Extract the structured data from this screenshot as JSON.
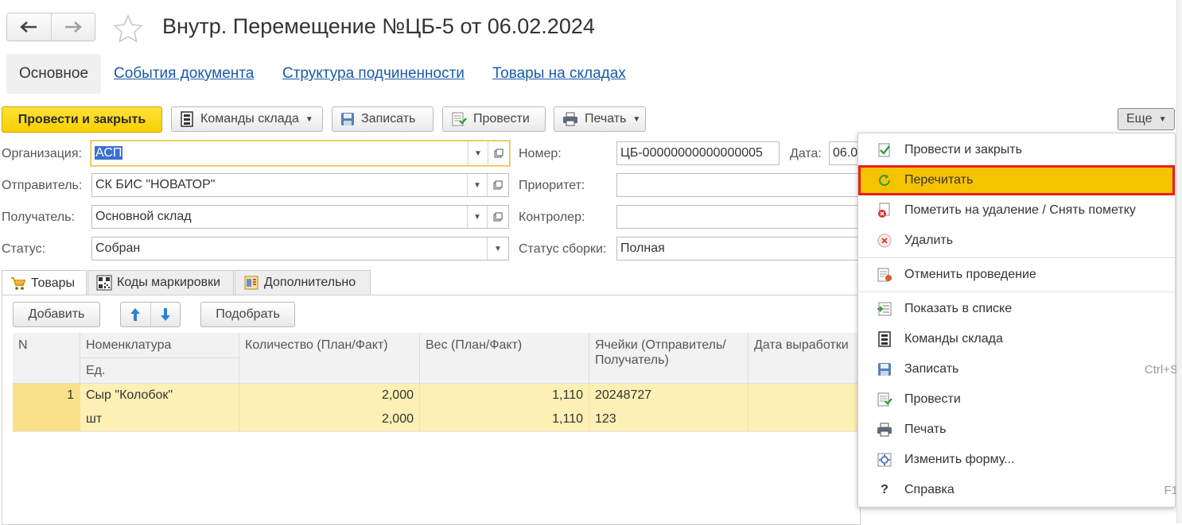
{
  "window": {
    "title": "Внутр. Перемещение №ЦБ-5 от 06.02.2024"
  },
  "nav": {
    "back": "🡐",
    "forward": "🡒"
  },
  "tabs": [
    {
      "label": "Основное"
    },
    {
      "label": "События документа"
    },
    {
      "label": "Структура подчиненности"
    },
    {
      "label": "Товары на складах"
    }
  ],
  "toolbar": {
    "post_close": "Провести и закрыть",
    "warehouse_cmds": "Команды склада",
    "save": "Записать",
    "post": "Провести",
    "print": "Печать",
    "more": "Еще"
  },
  "form": {
    "org_label": "Организация:",
    "org_value": "АСП",
    "sender_label": "Отправитель:",
    "sender_value": "СК БИС \"НОВАТОР\"",
    "receiver_label": "Получатель:",
    "receiver_value": "Основной склад",
    "status_label": "Статус:",
    "status_value": "Собран",
    "number_label": "Номер:",
    "number_value": "ЦБ-00000000000000005",
    "date_label": "Дата:",
    "date_value": "06.0",
    "priority_label": "Приоритет:",
    "priority_value": "",
    "controller_label": "Контролер:",
    "controller_value": "",
    "assembly_status_label": "Статус сборки:",
    "assembly_status_value": "Полная"
  },
  "lower_tabs": [
    {
      "label": "Товары"
    },
    {
      "label": "Коды маркировки"
    },
    {
      "label": "Дополнительно"
    }
  ],
  "table_toolbar": {
    "add": "Добавить",
    "pick": "Подобрать"
  },
  "table": {
    "headers": {
      "n": "N",
      "nomenclature": "Номенклатура",
      "unit": "Ед.",
      "quantity": "Количество (План/Факт)",
      "weight": "Вес (План/Факт)",
      "cells": "Ячейки (Отправитель/ Получатель)",
      "production_date": "Дата выработки"
    },
    "rows": [
      {
        "n": "1",
        "nomenclature": "Сыр \"Колобок\"",
        "unit": "шт",
        "qty_plan": "2,000",
        "qty_fact": "2,000",
        "weight_plan": "1,110",
        "weight_fact": "1,110",
        "cell_sender": "20248727",
        "cell_receiver": "123"
      }
    ]
  },
  "menu": {
    "items": [
      {
        "label": "Провести и закрыть",
        "icon": "post-close-icon",
        "shortcut": ""
      },
      {
        "label": "Перечитать",
        "icon": "refresh-icon",
        "shortcut": ""
      },
      {
        "label": "Пометить на удаление / Снять пометку",
        "icon": "mark-delete-icon",
        "shortcut": ""
      },
      {
        "label": "Удалить",
        "icon": "delete-icon",
        "shortcut": ""
      },
      {
        "label": "Отменить проведение",
        "icon": "unpost-icon",
        "shortcut": ""
      },
      {
        "label": "Показать в списке",
        "icon": "show-in-list-icon",
        "shortcut": ""
      },
      {
        "label": "Команды склада",
        "icon": "warehouse-icon",
        "shortcut": ""
      },
      {
        "label": "Записать",
        "icon": "save-icon",
        "shortcut": "Ctrl+S"
      },
      {
        "label": "Провести",
        "icon": "post-icon",
        "shortcut": ""
      },
      {
        "label": "Печать",
        "icon": "print-icon",
        "shortcut": ""
      },
      {
        "label": "Изменить форму...",
        "icon": "customize-form-icon",
        "shortcut": ""
      },
      {
        "label": "Справка",
        "icon": "help-icon",
        "shortcut": "F1"
      }
    ]
  },
  "colors": {
    "accent_yellow": "#f7d000",
    "link_blue": "#1a5aa8",
    "row_highlight": "#fdf0b4",
    "menu_highlight": "#f6c300",
    "highlight_border": "#e81e1e"
  }
}
